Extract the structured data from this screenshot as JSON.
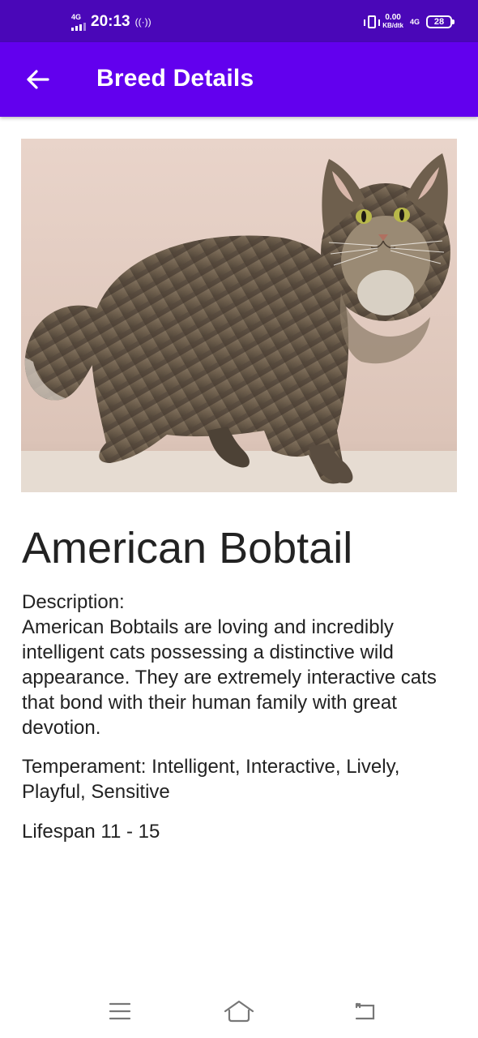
{
  "status_bar": {
    "network_left": "4G",
    "time": "20:13",
    "hotspot_glyph": "((·))",
    "speed_value": "0.00",
    "speed_unit": "KB/dtk",
    "network_right": "4G",
    "battery": "28",
    "icons": [
      "signal-icon",
      "hotspot-icon",
      "vibrate-icon",
      "battery-icon"
    ]
  },
  "app_bar": {
    "title": "Breed Details",
    "back_icon": "arrow-left-icon",
    "color": "#6200ee",
    "status_color": "#4a07b8"
  },
  "breed": {
    "image_subject": "cat-photo",
    "name": "American Bobtail",
    "description_label": "Description:",
    "description": "American Bobtails are loving and incredibly intelligent cats possessing a distinctive wild appearance. They are extremely interactive cats that bond with their human family with great devotion.",
    "temperament_label": "Temperament:",
    "temperament": "Intelligent, Interactive, Lively, Playful, Sensitive",
    "lifespan_label": "Lifespan",
    "lifespan": "11 - 15"
  },
  "nav": {
    "icons": [
      "menu-icon",
      "home-icon",
      "back-icon"
    ]
  }
}
